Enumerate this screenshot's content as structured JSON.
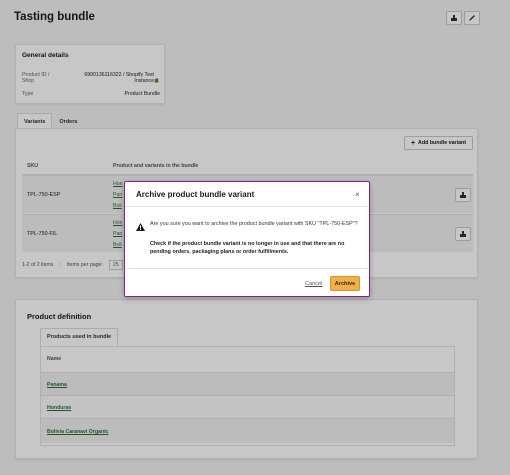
{
  "page": {
    "title": "Tasting bundle"
  },
  "header_actions": [
    {
      "icon": "archive-icon"
    },
    {
      "icon": "pencil-icon"
    }
  ],
  "general_details": {
    "title": "General details",
    "product_id_label": "Product ID / Shop",
    "product_id_value": "6900136116322 / Shopify Test Instance",
    "type_label": "Type",
    "type_value": "Product Bundle"
  },
  "tabs": [
    "Variants",
    "Orders"
  ],
  "variants": {
    "add_button": "Add bundle variant",
    "columns": [
      "SKU",
      "Product and variants in the bundle"
    ],
    "rows": [
      {
        "sku": "TPL-750-ESP",
        "links": [
          "Hon",
          "Pan",
          "Boli"
        ]
      },
      {
        "sku": "TPL-750-FIL",
        "links": [
          "Hon",
          "Pan",
          "Boli"
        ]
      }
    ],
    "pagination": {
      "range": "1-2 of 2 items",
      "per_page_label": "Items per page:",
      "per_page_value": "25"
    }
  },
  "product_definition": {
    "title": "Product definition",
    "tab": "Products used in bundle",
    "column": "Name",
    "rows": [
      "Panama",
      "Honduras",
      "Bolivia Caranavi Organic"
    ]
  },
  "modal": {
    "title": "Archive product bundle variant",
    "close": "×",
    "message": "Are you sure you want to archive the product bundle variant with SKU \"TPL-750-ESP\"?",
    "note": "Check if the product bundle variant is no longer in use and that there are no pending orders, packaging plans or order fulfillments.",
    "cancel": "Cancel",
    "confirm": "Archive"
  }
}
